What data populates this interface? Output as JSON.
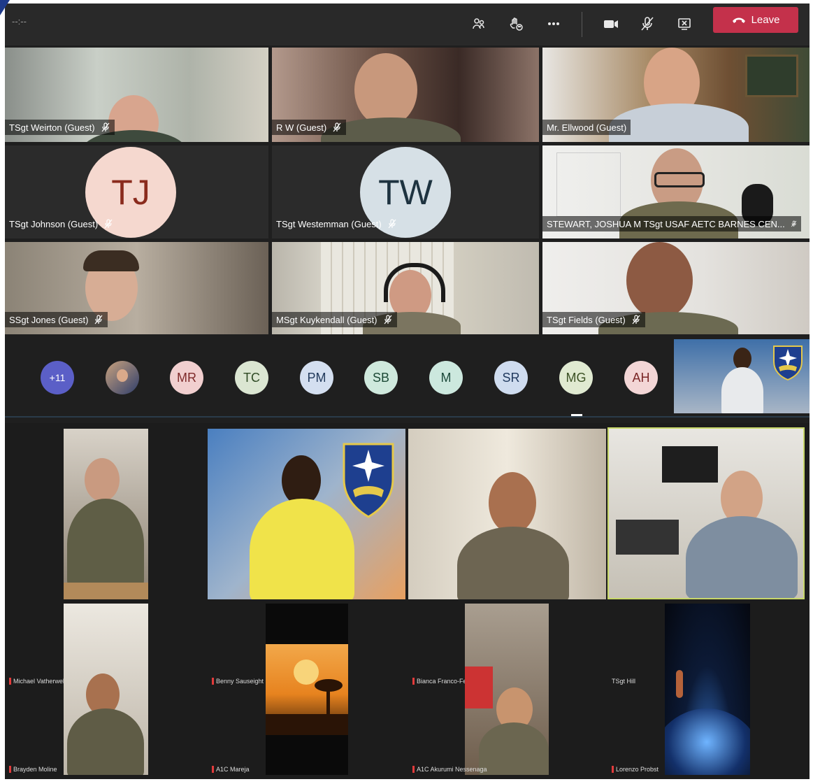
{
  "toolbar": {
    "timer": "--:--",
    "leave_label": "Leave"
  },
  "colors": {
    "leave": "#c4314b",
    "toolbar_bg": "#292929",
    "grid_bg": "#1f1f1f",
    "active_speaker_border": "#c8d86a"
  },
  "participants_grid": [
    {
      "name": "TSgt Weirton (Guest)",
      "muted": true
    },
    {
      "name": "R W (Guest)",
      "muted": true
    },
    {
      "name": "Mr. Ellwood (Guest)",
      "muted": false
    },
    {
      "name": "TSgt Johnson (Guest)",
      "muted": true,
      "initials": "TJ"
    },
    {
      "name": "TSgt Westemman (Guest)",
      "muted": true,
      "initials": "TW"
    },
    {
      "name": "STEWART, JOSHUA M TSgt USAF AETC BARNES CEN...",
      "muted": true
    },
    {
      "name": "SSgt Jones (Guest)",
      "muted": true
    },
    {
      "name": "MSgt Kuykendall (Guest)",
      "muted": true
    },
    {
      "name": "TSgt Fields (Guest)",
      "muted": true
    }
  ],
  "overflow": {
    "more_count": "+11",
    "avatars": [
      "MR",
      "TC",
      "PM",
      "SB",
      "M",
      "SR",
      "MG",
      "AH"
    ]
  },
  "zoom_grid": [
    {
      "name": "Michael Vatherwell"
    },
    {
      "name": "Benny Sauseight"
    },
    {
      "name": "Bianca Franco-Fernández"
    },
    {
      "name": "TSgt Hill"
    },
    {
      "name": "Brayden Moline"
    },
    {
      "name": "A1C Mareja"
    },
    {
      "name": "A1C Akurumi Nessenaga"
    },
    {
      "name": "Lorenzo Probst"
    }
  ]
}
